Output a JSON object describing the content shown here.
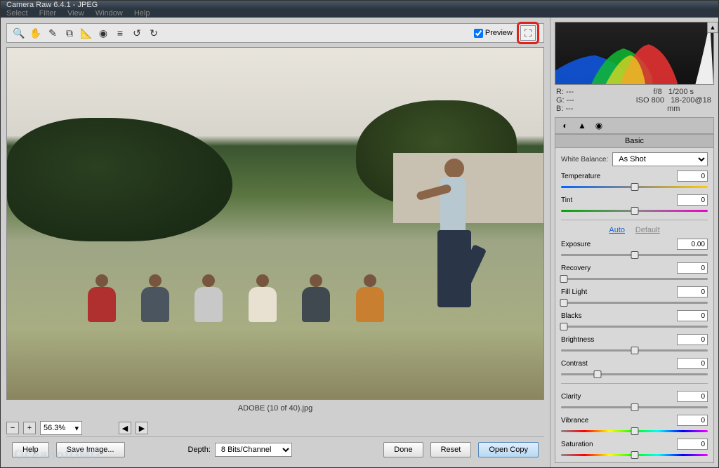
{
  "title": "Camera Raw 6.4.1  -  JPEG",
  "menu": [
    "Select",
    "Filter",
    "View",
    "Window",
    "Help"
  ],
  "toolbar": {
    "preview_label": "Preview"
  },
  "exif": {
    "r": "R:    ---",
    "g": "G:    ---",
    "b": "B:    ---",
    "fstop": "f/8",
    "shutter": "1/200 s",
    "iso": "ISO 800",
    "lens": "18-200@18 mm"
  },
  "panel": {
    "title": "Basic",
    "wb_label": "White Balance:",
    "wb_value": "As Shot",
    "auto": "Auto",
    "default": "Default",
    "sliders": {
      "temperature": {
        "label": "Temperature",
        "value": "0",
        "pos": 50,
        "track": "temp"
      },
      "tint": {
        "label": "Tint",
        "value": "0",
        "pos": 50,
        "track": "tint"
      },
      "exposure": {
        "label": "Exposure",
        "value": "0.00",
        "pos": 50,
        "track": "plain"
      },
      "recovery": {
        "label": "Recovery",
        "value": "0",
        "pos": 0,
        "track": "plain"
      },
      "filllight": {
        "label": "Fill Light",
        "value": "0",
        "pos": 0,
        "track": "plain"
      },
      "blacks": {
        "label": "Blacks",
        "value": "0",
        "pos": 0,
        "track": "plain"
      },
      "brightness": {
        "label": "Brightness",
        "value": "0",
        "pos": 50,
        "track": "plain"
      },
      "contrast": {
        "label": "Contrast",
        "value": "0",
        "pos": 25,
        "track": "plain"
      },
      "clarity": {
        "label": "Clarity",
        "value": "0",
        "pos": 50,
        "track": "plain"
      },
      "vibrance": {
        "label": "Vibrance",
        "value": "0",
        "pos": 50,
        "track": "sat"
      },
      "saturation": {
        "label": "Saturation",
        "value": "0",
        "pos": 50,
        "track": "sat"
      }
    }
  },
  "filename": "ADOBE (10 of 40).jpg",
  "zoom": "56.3%",
  "depth_label": "Depth:",
  "depth_value": "8 Bits/Channel",
  "buttons": {
    "help": "Help",
    "save": "Save Image...",
    "done": "Done",
    "reset": "Reset",
    "open": "Open Copy"
  },
  "watermark": "OceanofDMG"
}
